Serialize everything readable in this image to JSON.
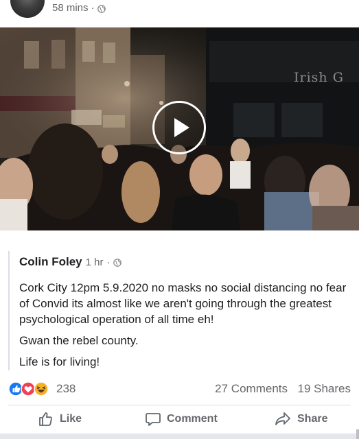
{
  "post": {
    "time": "58 mins",
    "separator": "·",
    "privacy_icon": "globe-icon"
  },
  "video": {
    "sign_text": "Irish G",
    "play_icon": "play-icon"
  },
  "shared_post": {
    "author": "Colin Foley",
    "time": "1 hr",
    "separator": "·",
    "privacy_icon": "globe-icon",
    "paragraphs": [
      "Cork City 12pm 5.9.2020 no masks no social distancing no fear of Convid its almost like we aren't going through the greatest psychological operation of all time eh!",
      "Gwan the rebel county.",
      "Life is for living!"
    ]
  },
  "engagement": {
    "reaction_icons": [
      "like-icon",
      "love-icon",
      "haha-icon"
    ],
    "reaction_count": "238",
    "comments": "27 Comments",
    "shares": "19 Shares"
  },
  "actions": {
    "like": "Like",
    "comment": "Comment",
    "share": "Share"
  },
  "colors": {
    "like_blue": "#1877f2",
    "love_red": "#f33e58",
    "haha_yellow": "#f7b125",
    "secondary_text": "#65676b"
  }
}
